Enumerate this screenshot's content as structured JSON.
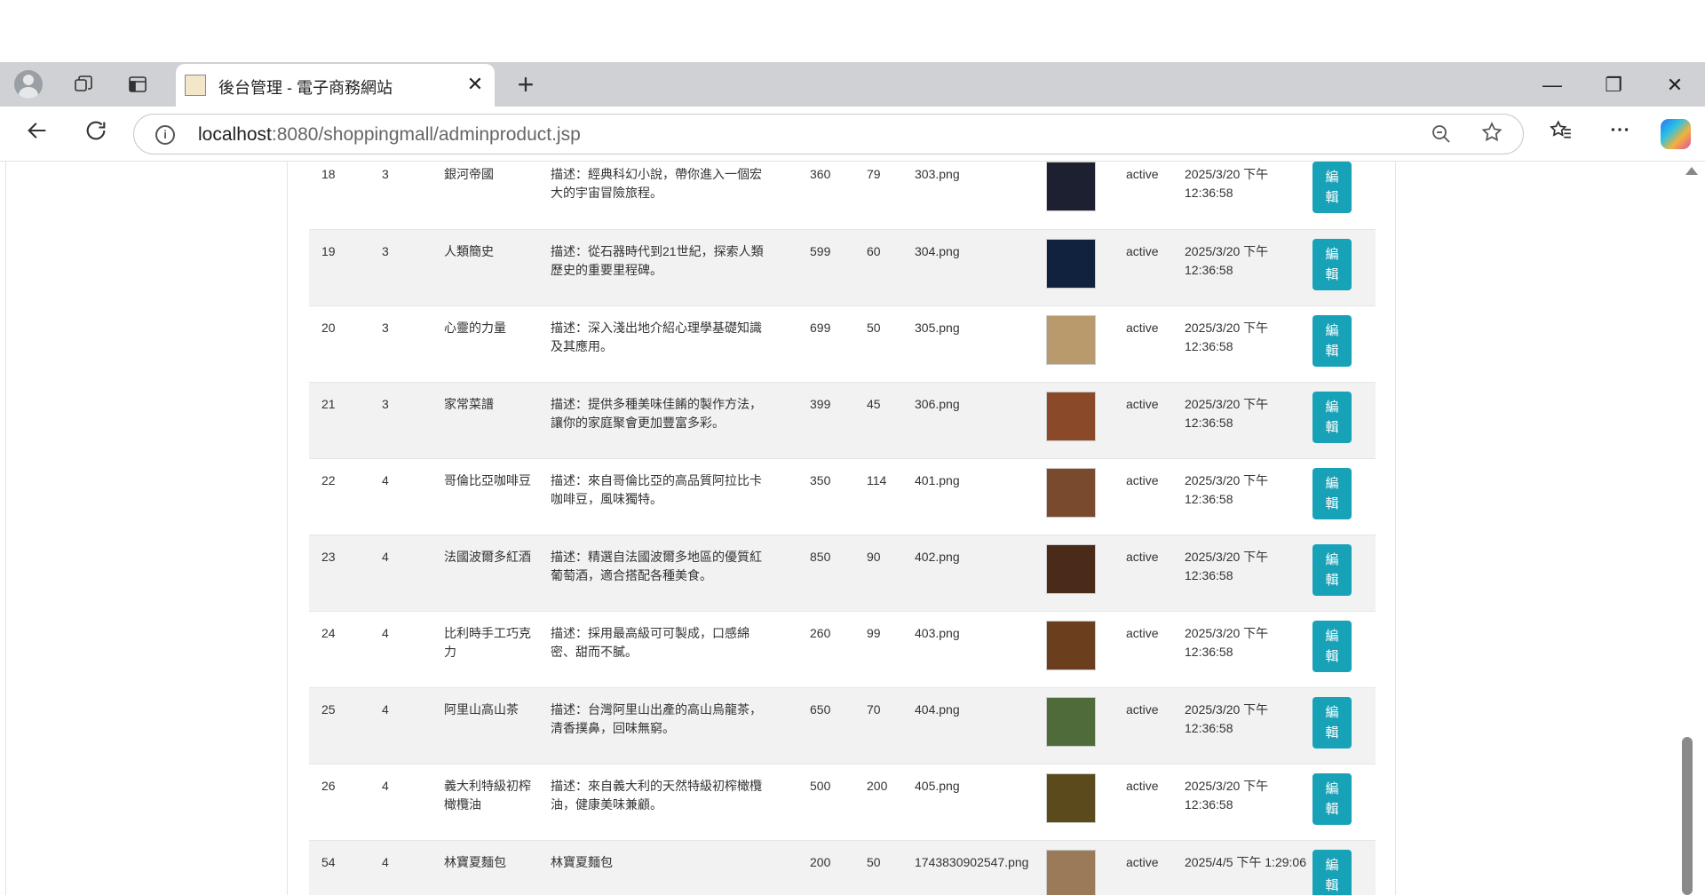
{
  "browser": {
    "tab_title": "後台管理 - 電子商務網站",
    "tab_close": "✕",
    "new_tab": "+",
    "url_host": "localhost",
    "url_rest": ":8080/shoppingmall/adminproduct.jsp",
    "win_minimize": "—",
    "win_restore": "❐",
    "win_close": "✕"
  },
  "table": {
    "rows": [
      {
        "id": "18",
        "cat": "3",
        "name": "銀河帝國",
        "desc": "描述：經典科幻小說，帶你進入一個宏大的宇宙冒險旅程。",
        "price": "360",
        "stock": "79",
        "file": "303.png",
        "status": "active",
        "time": "2025/3/20 下午 12:36:58",
        "edit": "編 輯",
        "img_color": "#1d2030"
      },
      {
        "id": "19",
        "cat": "3",
        "name": "人類簡史",
        "desc": "描述：從石器時代到21世紀，探索人類歷史的重要里程碑。",
        "price": "599",
        "stock": "60",
        "file": "304.png",
        "status": "active",
        "time": "2025/3/20 下午 12:36:58",
        "edit": "編 輯",
        "img_color": "#10223d"
      },
      {
        "id": "20",
        "cat": "3",
        "name": "心靈的力量",
        "desc": "描述：深入淺出地介紹心理學基礎知識及其應用。",
        "price": "699",
        "stock": "50",
        "file": "305.png",
        "status": "active",
        "time": "2025/3/20 下午 12:36:58",
        "edit": "編 輯",
        "img_color": "#b89a6c"
      },
      {
        "id": "21",
        "cat": "3",
        "name": "家常菜譜",
        "desc": "描述：提供多種美味佳餚的製作方法，讓你的家庭聚會更加豐富多彩。",
        "price": "399",
        "stock": "45",
        "file": "306.png",
        "status": "active",
        "time": "2025/3/20 下午 12:36:58",
        "edit": "編 輯",
        "img_color": "#8a4a2a"
      },
      {
        "id": "22",
        "cat": "4",
        "name": "哥倫比亞咖啡豆",
        "desc": "描述：來自哥倫比亞的高品質阿拉比卡咖啡豆，風味獨特。",
        "price": "350",
        "stock": "114",
        "file": "401.png",
        "status": "active",
        "time": "2025/3/20 下午 12:36:58",
        "edit": "編 輯",
        "img_color": "#7a4a2e"
      },
      {
        "id": "23",
        "cat": "4",
        "name": "法國波爾多紅酒",
        "desc": "描述：精選自法國波爾多地區的優質紅葡萄酒，適合搭配各種美食。",
        "price": "850",
        "stock": "90",
        "file": "402.png",
        "status": "active",
        "time": "2025/3/20 下午 12:36:58",
        "edit": "編 輯",
        "img_color": "#4a2a18"
      },
      {
        "id": "24",
        "cat": "4",
        "name": "比利時手工巧克力",
        "desc": "描述：採用最高級可可製成，口感綿密、甜而不膩。",
        "price": "260",
        "stock": "99",
        "file": "403.png",
        "status": "active",
        "time": "2025/3/20 下午 12:36:58",
        "edit": "編 輯",
        "img_color": "#6b3e1e"
      },
      {
        "id": "25",
        "cat": "4",
        "name": "阿里山高山茶",
        "desc": "描述：台灣阿里山出產的高山烏龍茶，清香撲鼻，回味無窮。",
        "price": "650",
        "stock": "70",
        "file": "404.png",
        "status": "active",
        "time": "2025/3/20 下午 12:36:58",
        "edit": "編 輯",
        "img_color": "#4f6b3a"
      },
      {
        "id": "26",
        "cat": "4",
        "name": "義大利特級初榨橄欖油",
        "desc": "描述：來自義大利的天然特級初榨橄欖油，健康美味兼顧。",
        "price": "500",
        "stock": "200",
        "file": "405.png",
        "status": "active",
        "time": "2025/3/20 下午 12:36:58",
        "edit": "編 輯",
        "img_color": "#5a4a1c"
      },
      {
        "id": "54",
        "cat": "4",
        "name": "林寶夏麵包",
        "desc": "林寶夏麵包",
        "price": "200",
        "stock": "50",
        "file": "1743830902547.png",
        "status": "active",
        "time": "2025/4/5 下午 1:29:06",
        "edit": "編 輯",
        "img_color": "#9a7a58"
      }
    ]
  }
}
